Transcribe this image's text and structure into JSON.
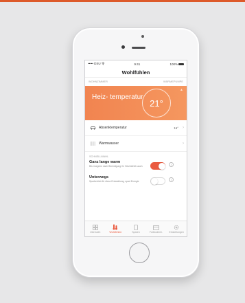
{
  "colors": {
    "accent": "#ea5b40",
    "card": "#f38d58",
    "page_bg": "#e7e7e8"
  },
  "status_bar": {
    "carrier": "••••• DSU 令",
    "time": "9:41",
    "battery": "100%"
  },
  "screen": {
    "title": "Wohlfühlen"
  },
  "subheader": {
    "left": "WOHNZIMMER",
    "right": "WÄRMEPUMPE"
  },
  "heat_card": {
    "label": "Heiz- temperatur",
    "value": "21°",
    "icon": "chevron-up-icon"
  },
  "rows": [
    {
      "label": "Absenktemperatur",
      "value": "16°",
      "icon": "car-icon"
    },
    {
      "label": "Warmwasser",
      "value": "",
      "icon": "water-icon"
    }
  ],
  "section": {
    "title": "SCHNELLWAHL"
  },
  "toggles": [
    {
      "title": "Ganz lange warm",
      "desc": "Bis morgens nach Beendigung Ihr Heizbetrieb auch",
      "state": "on"
    },
    {
      "title": "Unterwegs",
      "desc": "Sparbetrieb für diese Entwicklung, spart Energie",
      "state": "off"
    }
  ],
  "tabs": [
    {
      "label": "Übersicht",
      "icon": "grid-icon",
      "active": false
    },
    {
      "label": "Wohlfühlen",
      "icon": "thermometer-icon",
      "active": true
    },
    {
      "label": "Sparen",
      "icon": "leaf-icon",
      "active": false
    },
    {
      "label": "Fußbodenh.",
      "icon": "calendar-icon",
      "active": false
    },
    {
      "label": "Einstellungen",
      "icon": "gear-icon",
      "active": false
    }
  ]
}
